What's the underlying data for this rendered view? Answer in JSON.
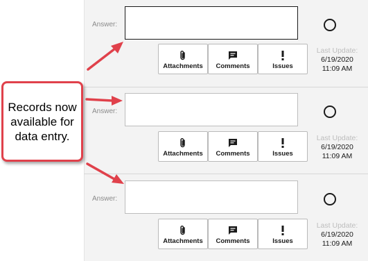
{
  "records": [
    {
      "answer_label": "Answer:",
      "answer_value": "",
      "buttons": {
        "attachments": "Attachments",
        "comments": "Comments",
        "issues": "Issues"
      },
      "last_update_label": "Last Update:",
      "last_update_date": "6/19/2020",
      "last_update_time": "11:09 AM"
    },
    {
      "answer_label": "Answer:",
      "answer_value": "",
      "buttons": {
        "attachments": "Attachments",
        "comments": "Comments",
        "issues": "Issues"
      },
      "last_update_label": "Last Update:",
      "last_update_date": "6/19/2020",
      "last_update_time": "11:09 AM"
    },
    {
      "answer_label": "Answer:",
      "answer_value": "",
      "buttons": {
        "attachments": "Attachments",
        "comments": "Comments",
        "issues": "Issues"
      },
      "last_update_label": "Last Update:",
      "last_update_date": "6/19/2020",
      "last_update_time": "11:09 AM"
    }
  ],
  "callout": {
    "text": "Records now available for data entry."
  },
  "icons": [
    "paperclip-icon",
    "comment-icon",
    "exclamation-icon",
    "radio-circle"
  ],
  "colors": {
    "callout_border": "#e0414b",
    "arrow": "#e0414b",
    "panel_bg": "#f3f3f3"
  }
}
